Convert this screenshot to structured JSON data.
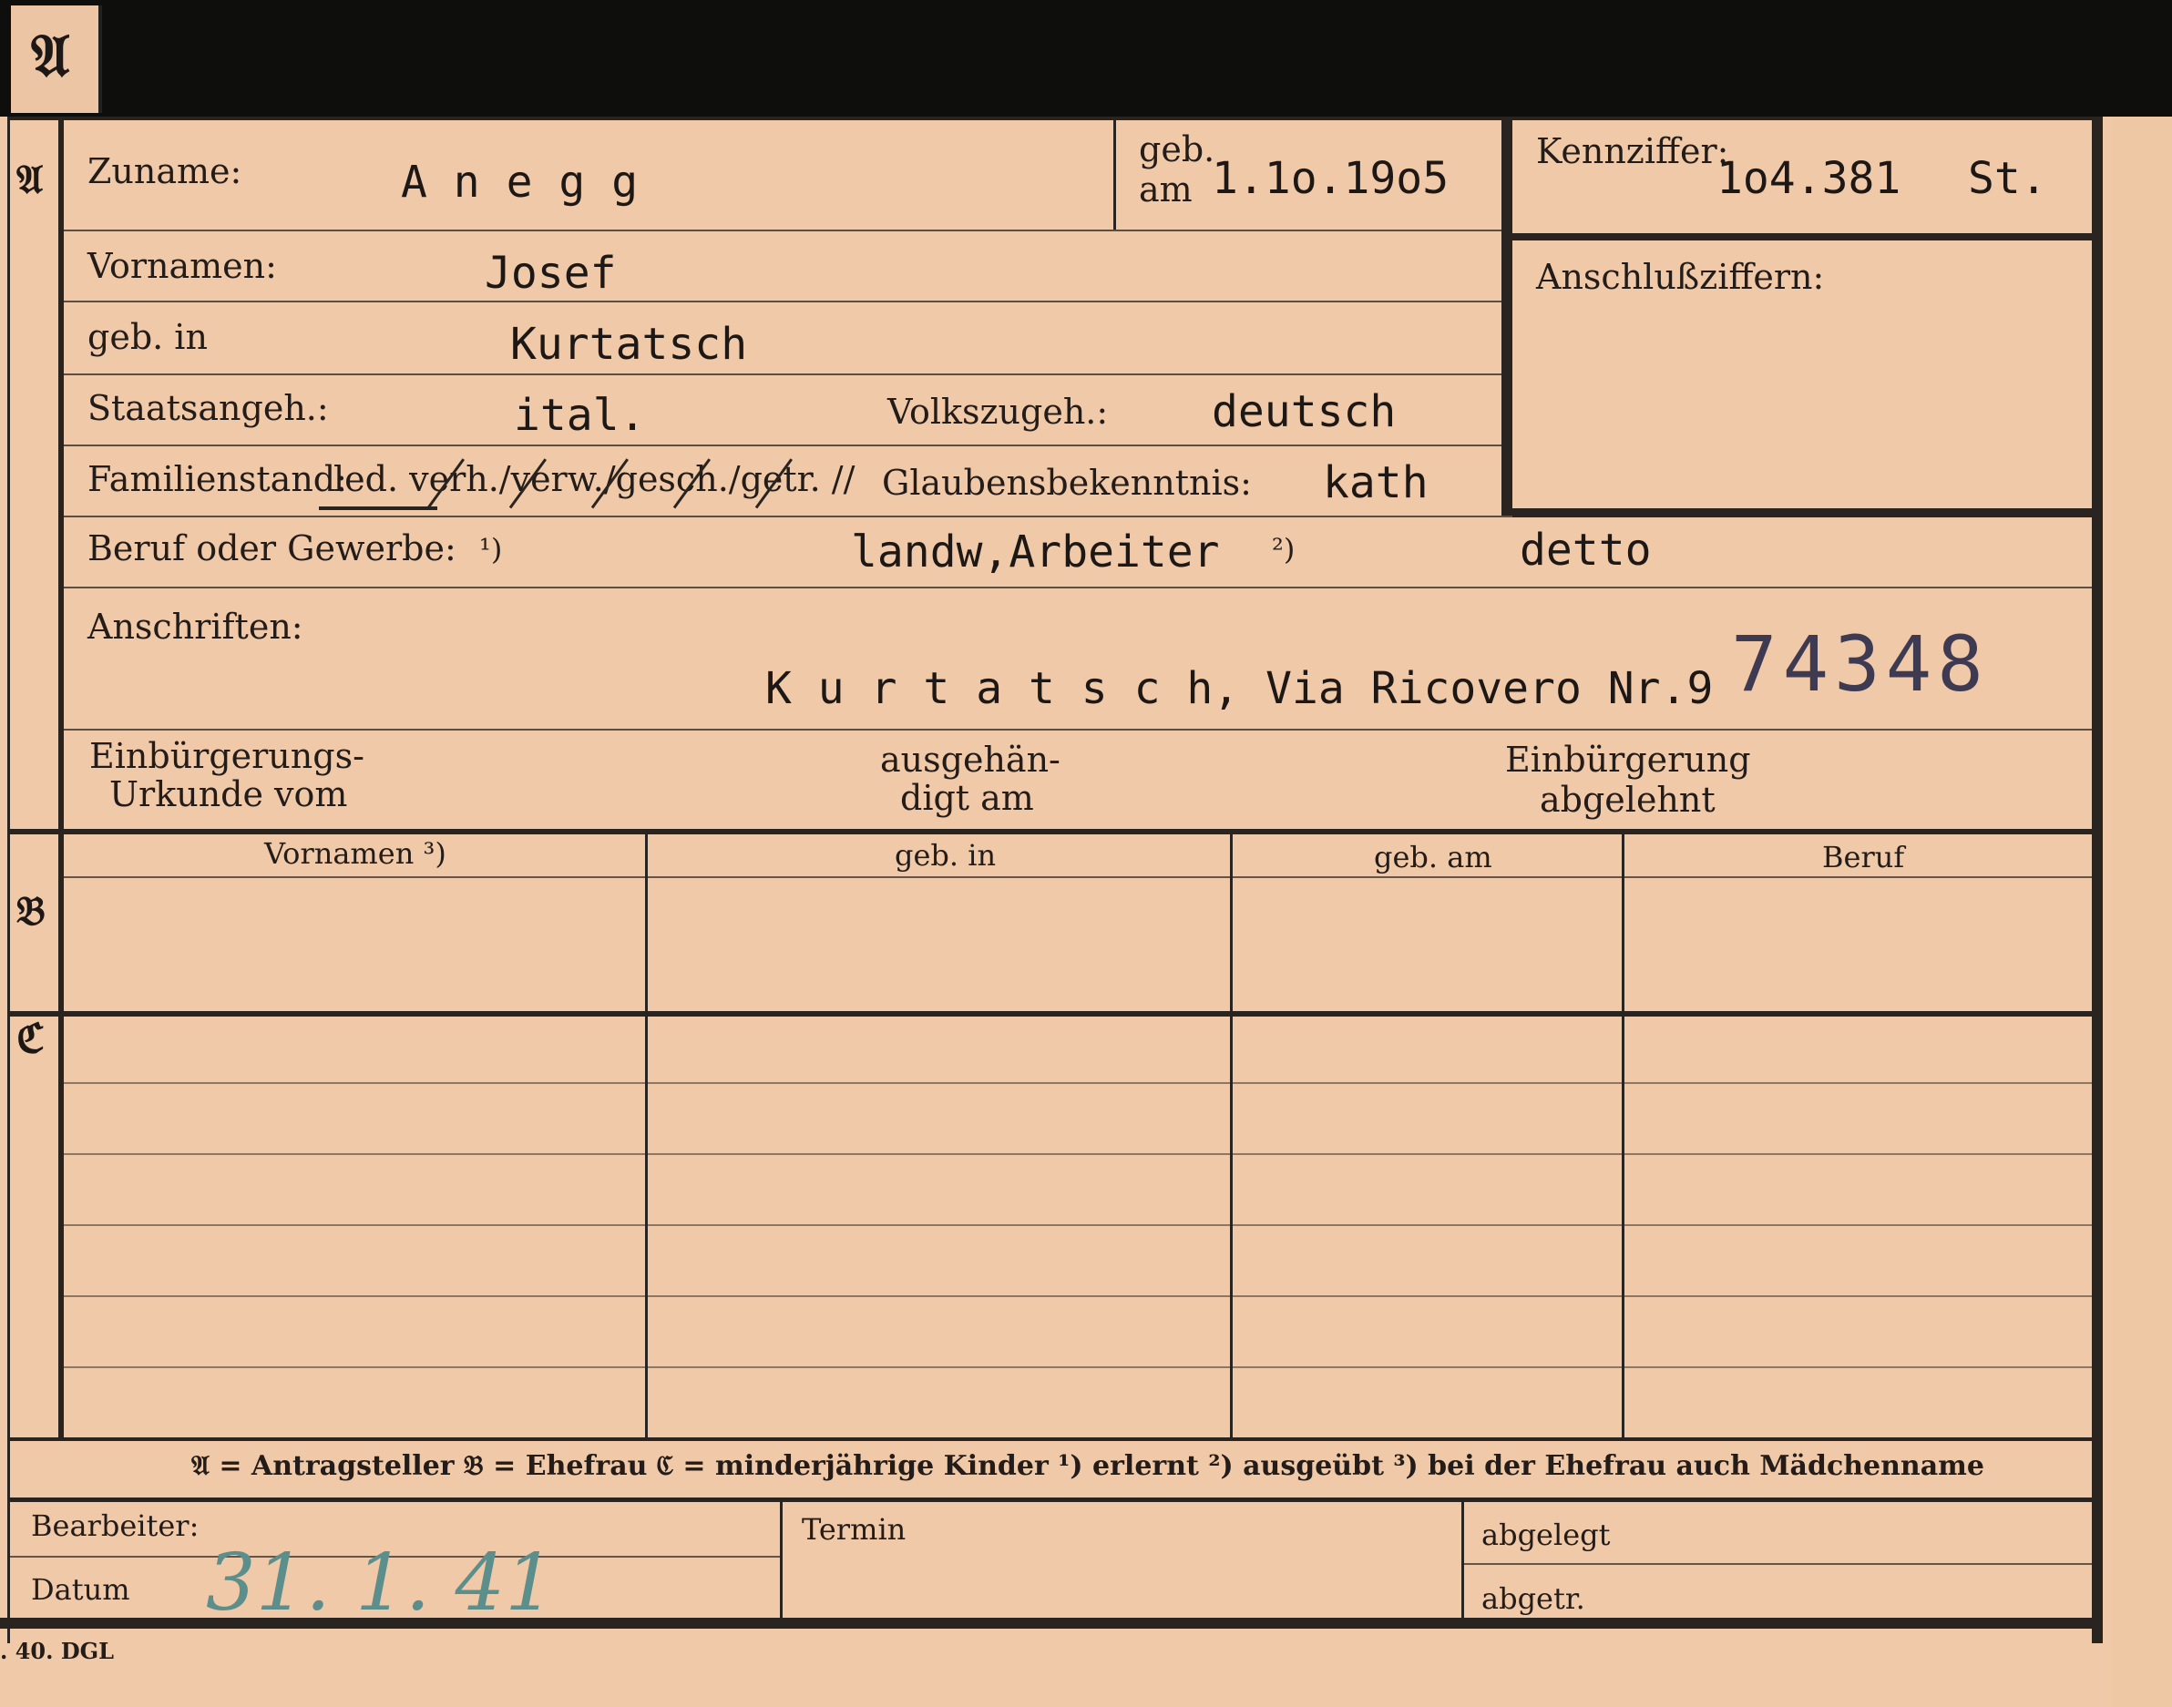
{
  "sections": {
    "a": "𝔄",
    "b": "𝔅",
    "c": "ℭ"
  },
  "labels": {
    "zuname": "Zuname:",
    "geb_am_1": "geb.",
    "geb_am_2": "am",
    "kennziffer": "Kennziffer:",
    "vornamen": "Vornamen:",
    "anschlussziffern": "Anschlußziffern:",
    "geb_in": "geb. in",
    "staatsangeh": "Staatsangeh.:",
    "volkszugeh": "Volkszugeh.:",
    "familienstand": "Familienstand:",
    "familienstand_options": "led. verh./verw./gesch./getr. //",
    "glaubensbekenntnis": "Glaubensbekenntnis:",
    "beruf": "Beruf oder Gewerbe:",
    "footnote_1": "¹)",
    "footnote_2": "²)",
    "anschriften": "Anschriften:",
    "einbuergerungs_1": "Einbürgerungs-",
    "einbuergerungs_2": "Urkunde vom",
    "ausgehaendigt_1": "ausgehän-",
    "ausgehaendigt_2": "digt am",
    "einbuergerung_abgelehnt_1": "Einbürgerung",
    "einbuergerung_abgelehnt_2": "abgelehnt",
    "bearbeiter": "Bearbeiter:",
    "datum": "Datum",
    "termin": "Termin",
    "abgelegt": "abgelegt",
    "abgetr": "abgetr."
  },
  "values": {
    "zuname": "A n e g g",
    "geb_am": "1.1o.19o5",
    "kennziffer": "1o4.381",
    "kennziffer_suffix": "St.",
    "vornamen": "Josef",
    "geb_in": "Kurtatsch",
    "staatsangeh": "ital.",
    "volkszugeh": "deutsch",
    "glaubensbekenntnis": "kath",
    "beruf_erlernt": "landw,Arbeiter",
    "beruf_ausgeuebt": "detto",
    "anschrift": "K u r t a t s c h,  Via Ricovero  Nr.9",
    "stamp_number": "74348",
    "datum_handwritten": "31. 1. 41"
  },
  "table": {
    "headers": [
      "Vornamen ³)",
      "geb. in",
      "geb. am",
      "Beruf"
    ]
  },
  "legend": "𝔄 = Antragsteller   𝔅 = Ehefrau   ℭ = minderjährige Kinder   ¹) erlernt   ²) ausgeübt   ³) bei der Ehefrau auch Mädchenname",
  "print_code": ". 40. DGL",
  "colors": {
    "card": "#f0c9a8",
    "ink": "#231c18",
    "handwriting": "#5c8f8c",
    "stamp": "#3d3a52"
  }
}
